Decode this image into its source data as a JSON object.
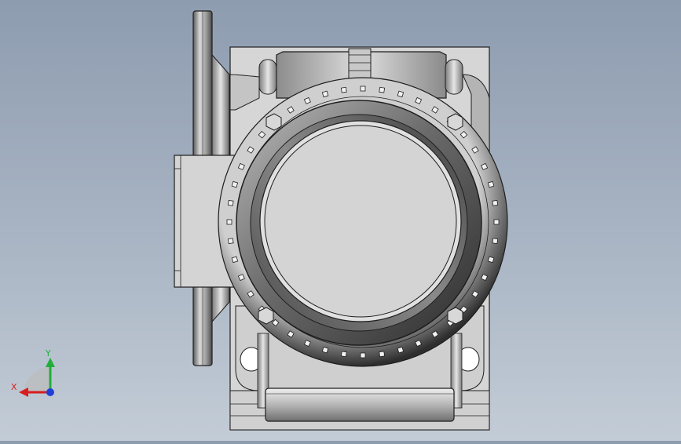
{
  "axis_triad": {
    "x_label": "X",
    "y_label": "Y",
    "x_color": "#d81e1e",
    "y_color": "#1fae3a",
    "z_color": "#1f3fd8"
  },
  "colors": {
    "background_top": "#8e9cb0",
    "background_bottom": "#c3ccd6",
    "part_fill": "#d6d6d6",
    "edge": "#1e1e1e"
  }
}
